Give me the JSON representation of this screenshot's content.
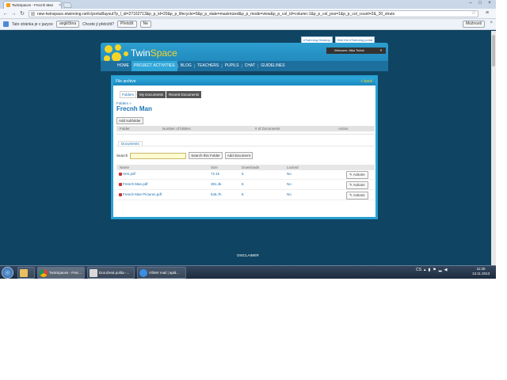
{
  "browser": {
    "tab_title": "TwinSpaces - Frecnh Man",
    "url": "new-twinspace.etwinning.net/c/portal/layout?p_l_id=27162713&p_p_id=20&p_p_lifecycle=0&p_p_state=maximized&p_p_mode=view&p_p_col_id=column-1&p_p_col_pos=1&p_p_col_count=2&_20_struts"
  },
  "translate_bar": {
    "text": "Tato stránka je v jazyce",
    "language": "angličtina",
    "question": "Chcete ji přeložit?",
    "translate_btn": "Přeložit",
    "no_btn": "Ne",
    "options_btn": "Možnosti"
  },
  "top_links": [
    "eTwinning Desktop",
    "Visit the eTwinning portal"
  ],
  "header": {
    "brand_a": "Twin",
    "brand_b": "Space",
    "welcome": "Welcome Jitka Tichal"
  },
  "nav": [
    "HOME",
    "PROJECT ACTIVITIES",
    "BLOG",
    "TEACHERS",
    "PUPILS",
    "CHAT",
    "GUIDELINES"
  ],
  "file_archive": {
    "title": "File archive",
    "back": "back",
    "tabs": [
      "Folders",
      "My Documents",
      "Recent Documents"
    ],
    "breadcrumb": "Folders »",
    "page_title": "Frecnh Man",
    "add_subfolder": "Add subfolder",
    "folder_headers": [
      "Folder",
      "Number of folders",
      "# of Documents",
      "Action"
    ],
    "documents_label": "Documents",
    "search_label": "Search",
    "search_value": "",
    "search_folder_btn": "Search this Folder",
    "add_document_btn": "Add document",
    "doc_headers": [
      "Name",
      "Size",
      "Downloads",
      "Locked"
    ],
    "documents": [
      {
        "name": "Hen.pdf",
        "size": "72.1k",
        "downloads": "5",
        "locked": "No",
        "action": "Actions"
      },
      {
        "name": "French Man.pdf",
        "size": "381.4k",
        "downloads": "6",
        "locked": "No",
        "action": "Actions"
      },
      {
        "name": "French Man Pictures.pdf",
        "size": "546.7k",
        "downloads": "6",
        "locked": "No",
        "action": "Actions"
      }
    ]
  },
  "footer": "DISCLAIMER",
  "taskbar": {
    "items": [
      "TwinSpaces - Frec...",
      "Doručená pošta -...",
      "VŠMV mail | aplá..."
    ],
    "lang": "CS",
    "time": "11:25",
    "date": "13.11.2013"
  }
}
